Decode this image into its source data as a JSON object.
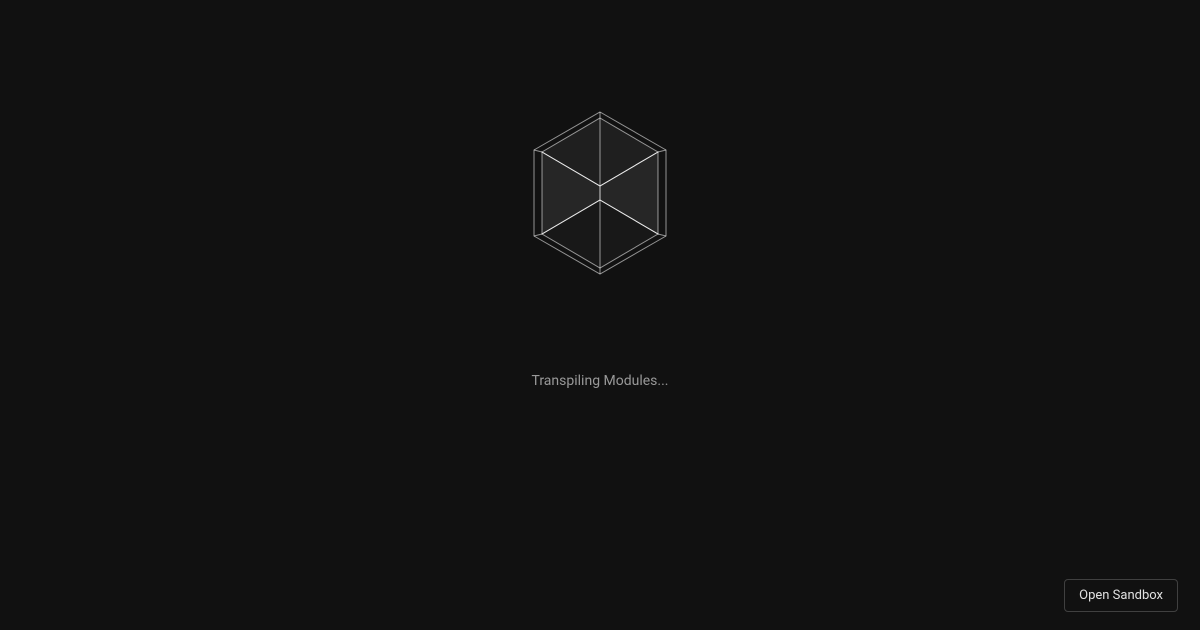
{
  "loading": {
    "status_text": "Transpiling Modules..."
  },
  "footer": {
    "open_sandbox_label": "Open Sandbox"
  },
  "colors": {
    "background": "#111111",
    "text_muted": "#999999",
    "border": "rgba(255,255,255,0.2)",
    "icon_stroke": "rgba(255,255,255,0.6)",
    "icon_fill": "rgba(255,255,255,0.05)"
  }
}
